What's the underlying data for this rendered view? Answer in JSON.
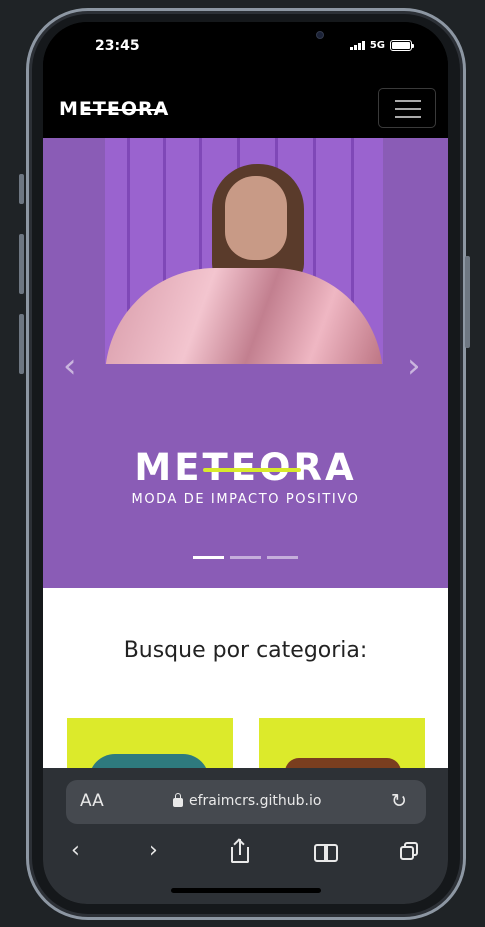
{
  "status": {
    "time": "23:45",
    "network": "5G"
  },
  "navbar": {
    "logo": "METEORA"
  },
  "carousel": {
    "brand": "METEORA",
    "tagline": "MODA DE IMPACTO POSITIVO",
    "prev_icon": "chevron-left-icon",
    "next_icon": "chevron-right-icon",
    "slide_count": 3,
    "active_slide": 1
  },
  "main": {
    "section_title": "Busque por categoria:"
  },
  "browser": {
    "text_size_label": "AA",
    "url": "efraimcrs.github.io"
  },
  "colors": {
    "purple": "#8a5cb6",
    "accent": "#d8ea2c",
    "navbar": "#000000"
  }
}
